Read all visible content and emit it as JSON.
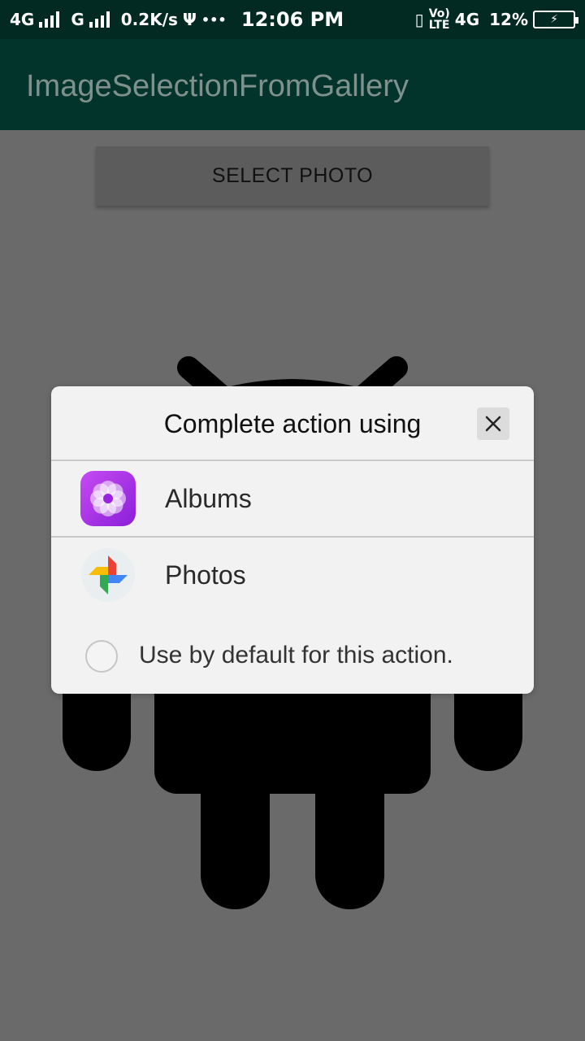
{
  "status_bar": {
    "network_left": "4G",
    "network_g": "G",
    "speed": "0.2K/s",
    "dots": "•••",
    "time": "12:06 PM",
    "volte_top": "Vo)",
    "volte_bottom": "LTE",
    "network_right": "4G",
    "battery": "12%"
  },
  "app_bar": {
    "title": "ImageSelectionFromGallery"
  },
  "main": {
    "select_button_label": "SELECT PHOTO"
  },
  "dialog": {
    "title": "Complete action using",
    "items": [
      {
        "label": "Albums",
        "icon": "albums-icon"
      },
      {
        "label": "Photos",
        "icon": "google-photos-icon"
      }
    ],
    "default_label": "Use by default for this action."
  },
  "colors": {
    "status_bar": "#022a23",
    "app_bar": "#02342b",
    "scrim": "#6a6a6a",
    "dialog_bg": "#f2f2f2"
  }
}
